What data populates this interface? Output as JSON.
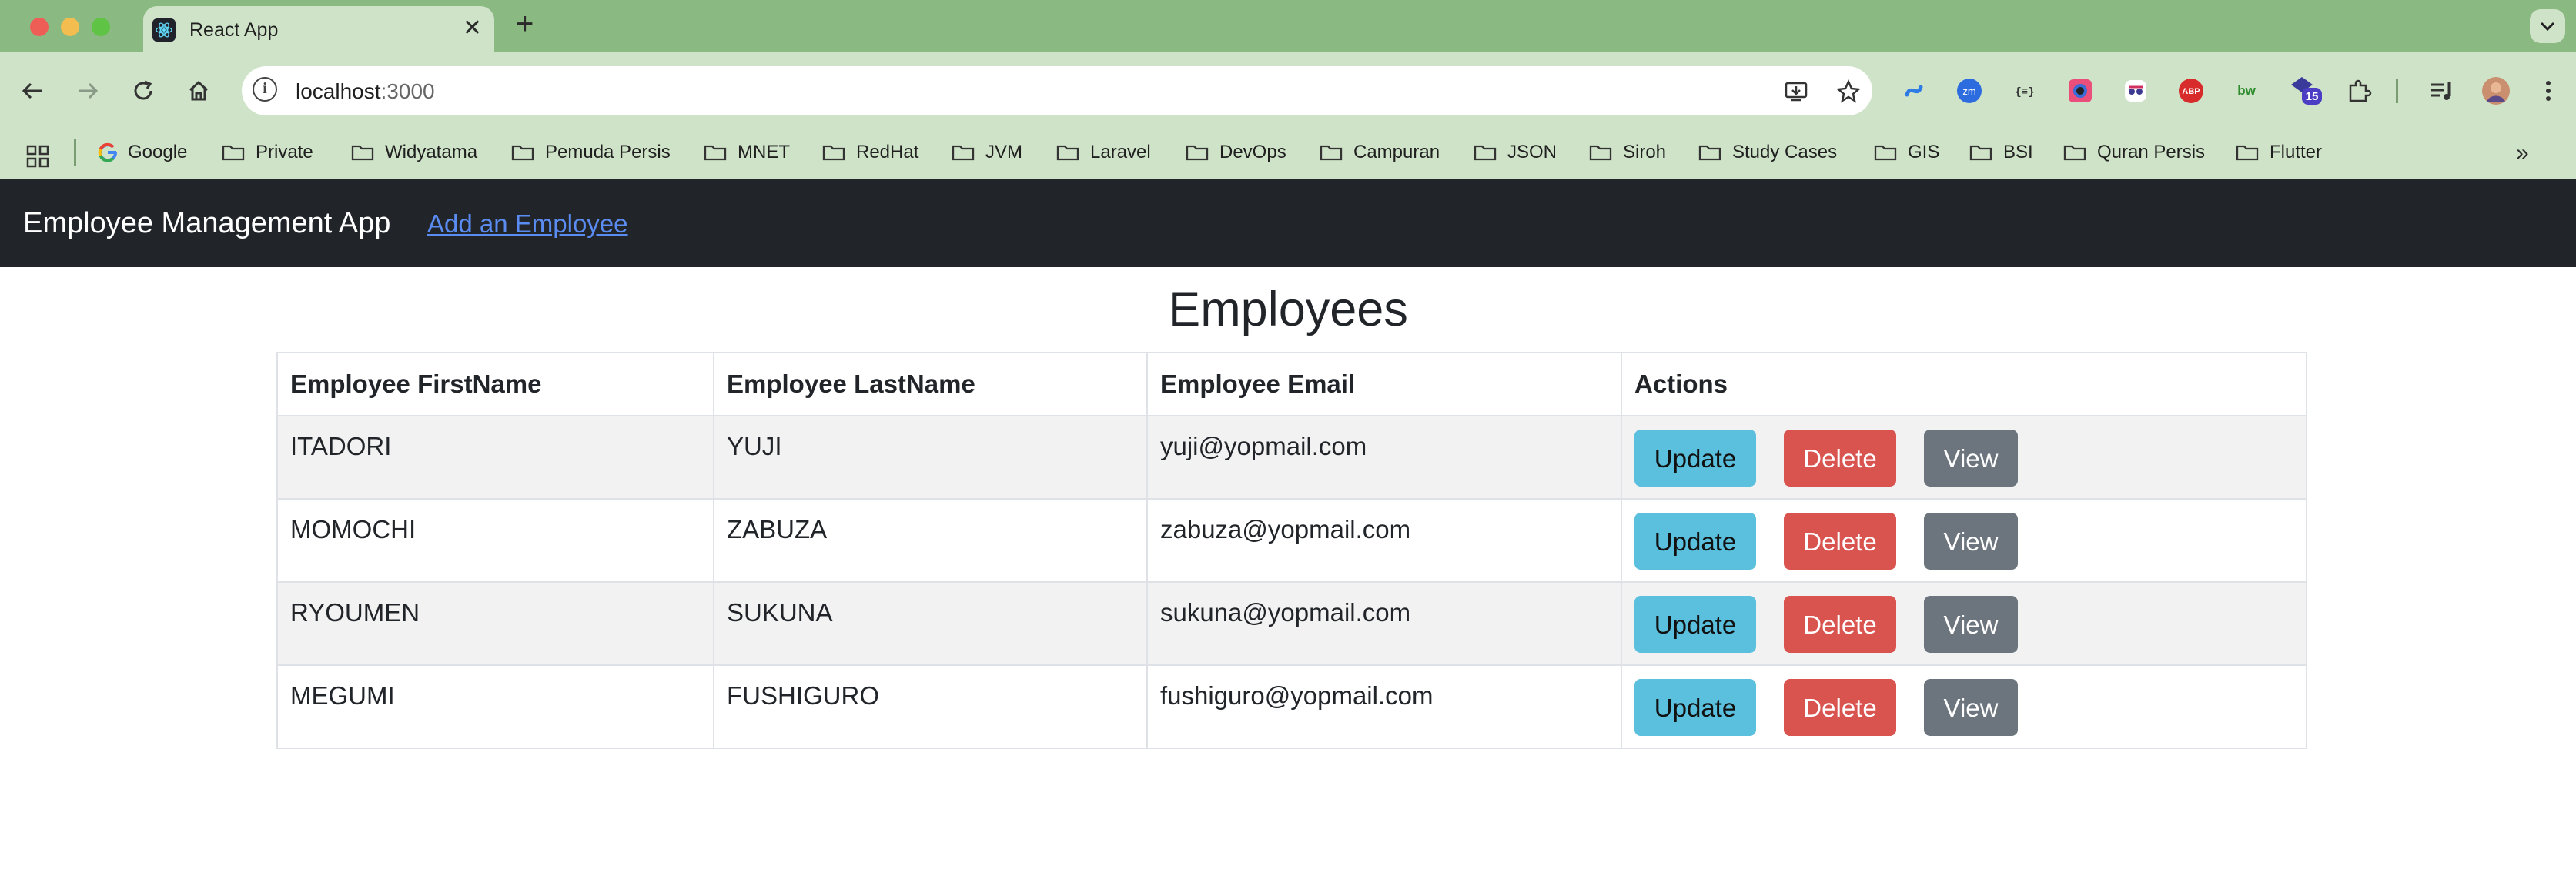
{
  "browser": {
    "tab_title": "React App",
    "address": {
      "host": "localhost",
      "port": ":3000"
    },
    "bookmarks": [
      "Google",
      "Private",
      "Widyatama",
      "Pemuda Persis",
      "MNET",
      "RedHat",
      "JVM",
      "Laravel",
      "DevOps",
      "Campuran",
      "JSON",
      "Siroh",
      "Study Cases",
      "GIS",
      "BSI",
      "Quran Persis",
      "Flutter"
    ],
    "extensions": {
      "zm_label": "zm",
      "json_label": "{≡}",
      "abp_label": "ABP",
      "bw_label": "bw",
      "badge_count": "15"
    }
  },
  "app": {
    "brand": "Employee Management App",
    "nav_link": "Add an Employee",
    "page_title": "Employees",
    "table": {
      "headers": [
        "Employee FirstName",
        "Employee LastName",
        "Employee Email",
        "Actions"
      ],
      "rows": [
        {
          "first": "ITADORI",
          "last": "YUJI",
          "email": "yuji@yopmail.com"
        },
        {
          "first": "MOMOCHI",
          "last": "ZABUZA",
          "email": "zabuza@yopmail.com"
        },
        {
          "first": "RYOUMEN",
          "last": "SUKUNA",
          "email": "sukuna@yopmail.com"
        },
        {
          "first": "MEGUMI",
          "last": "FUSHIGURO",
          "email": "fushiguro@yopmail.com"
        }
      ]
    },
    "buttons": {
      "update": "Update",
      "delete": "Delete",
      "view": "View"
    }
  },
  "colors": {
    "navbar": "#212529",
    "link": "#5a8cf2",
    "update": "#5bc0de",
    "delete": "#d9534f",
    "view": "#6c757d"
  }
}
